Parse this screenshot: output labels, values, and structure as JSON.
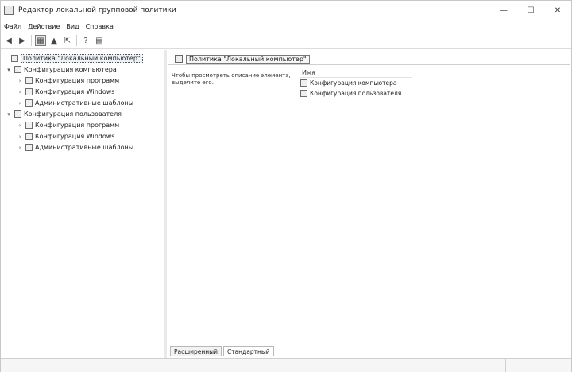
{
  "window": {
    "title": "Редактор локальной групповой политики",
    "minimize": "—",
    "maximize": "☐",
    "close": "✕"
  },
  "menu": {
    "items": [
      "Файл",
      "Действие",
      "Вид",
      "Справка"
    ]
  },
  "toolbar": {
    "back": "◀",
    "forward": "▶",
    "up": "▲",
    "show_hide": "▦",
    "export": "⇱",
    "properties": "▤",
    "help": "?"
  },
  "tree": {
    "items": [
      {
        "label": "Политика \"Локальный компьютер\"",
        "expander": ""
      },
      {
        "label": "Конфигурация компьютера",
        "expander": "▾"
      },
      {
        "label": "Конфигурация программ",
        "expander": "›"
      },
      {
        "label": "Конфигурация Windows",
        "expander": "›"
      },
      {
        "label": "Административные шаблоны",
        "expander": "›"
      },
      {
        "label": "Конфигурация пользователя",
        "expander": "▾"
      },
      {
        "label": "Конфигурация программ",
        "expander": "›"
      },
      {
        "label": "Конфигурация Windows",
        "expander": "›"
      },
      {
        "label": "Административные шаблоны",
        "expander": "›"
      }
    ]
  },
  "content": {
    "header": "Политика \"Локальный компьютер\"",
    "description": "Чтобы просмотреть описание элемента, выделите его.",
    "list_header": "Имя",
    "items": [
      "Конфигурация компьютера",
      "Конфигурация пользователя"
    ],
    "tabs": [
      "Расширенный",
      "Стандартный"
    ]
  },
  "status": {
    "segments": [
      "",
      "",
      ""
    ]
  }
}
